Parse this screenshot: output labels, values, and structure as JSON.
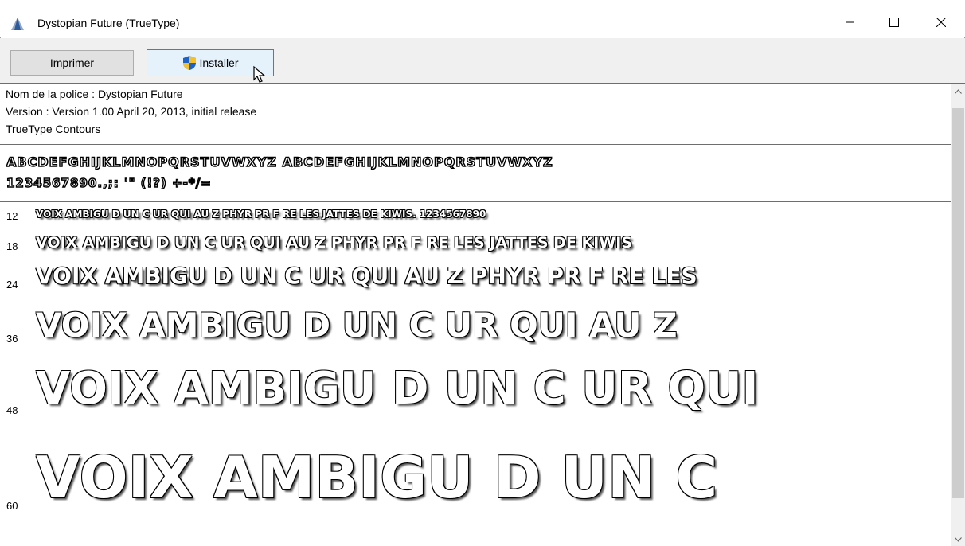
{
  "window": {
    "title": "Dystopian Future (TrueType)",
    "icons": [
      "font-app-icon",
      "minimize-icon",
      "maximize-icon",
      "close-icon"
    ]
  },
  "toolbar": {
    "print_label": "Imprimer",
    "install_label": "Installer"
  },
  "font_info": {
    "name_line": "Nom de la police : Dystopian Future",
    "version_line": "Version : Version 1.00 April 20, 2013, initial release",
    "type_line": "TrueType  Contours"
  },
  "charset": {
    "line1": "ABCDEFGHIJKLMNOPQRSTUVWXYZ ABCDEFGHIJKLMNOPQRSTUVWXYZ",
    "line2": "1234567890.,;: '\" (!?) +-*/="
  },
  "samples": [
    {
      "size": "12",
      "text": "VOIX AMBIGU D UN C UR QUI AU Z PHYR PR F RE LES JATTES DE KIWIS. 1234567890"
    },
    {
      "size": "18",
      "text": "VOIX AMBIGU D UN C UR QUI AU Z PHYR PR F RE LES JATTES DE KIWIS"
    },
    {
      "size": "24",
      "text": "VOIX AMBIGU D UN C UR QUI AU Z PHYR PR F RE LES"
    },
    {
      "size": "36",
      "text": "VOIX AMBIGU D UN C UR QUI AU Z"
    },
    {
      "size": "48",
      "text": "VOIX AMBIGU D UN C UR QUI"
    },
    {
      "size": "60",
      "text": "VOIX AMBIGU D UN C"
    }
  ],
  "colors": {
    "install_border": "#3a7ed9",
    "install_bg": "#e5f1fb",
    "toolbar_bg": "#f0f0f0"
  }
}
